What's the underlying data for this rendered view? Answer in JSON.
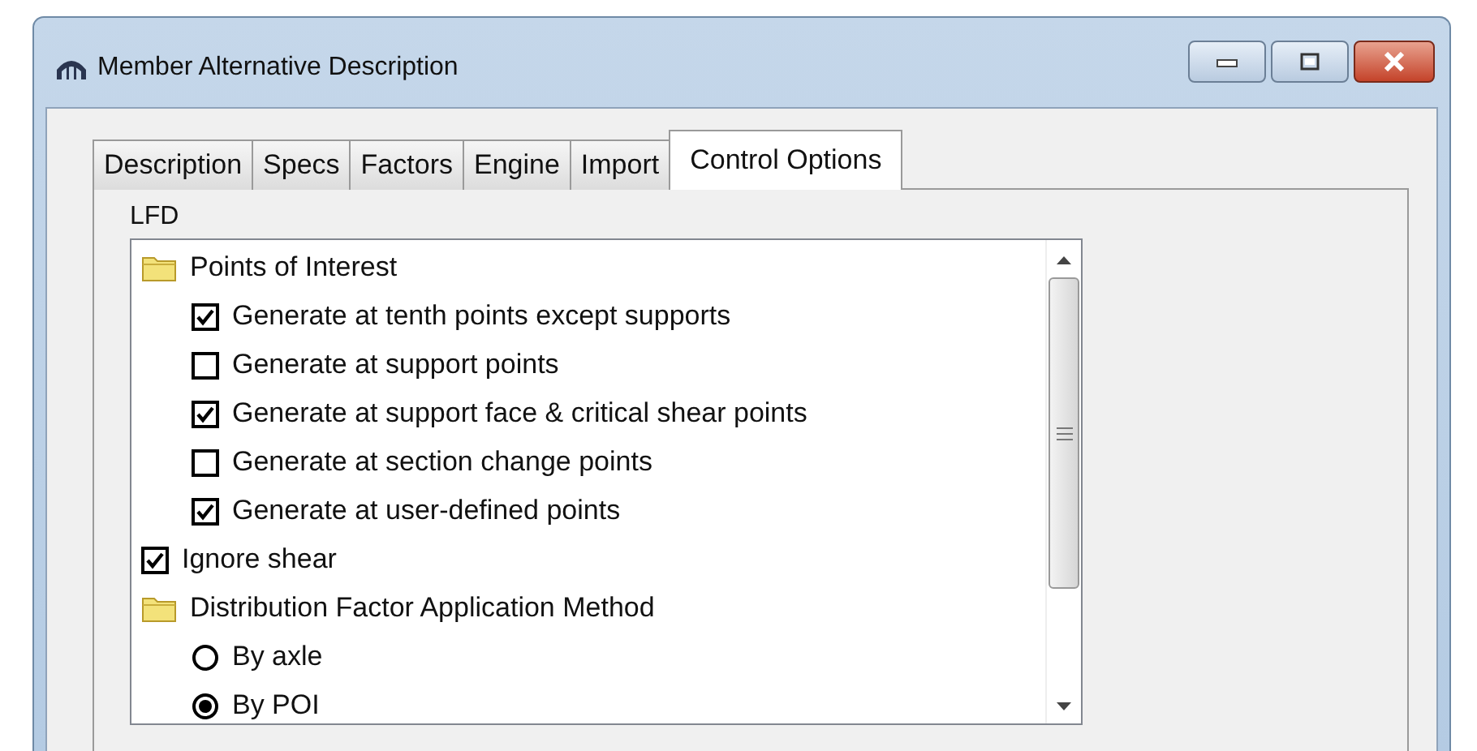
{
  "window": {
    "title": "Member Alternative Description"
  },
  "tabs": [
    {
      "label": "Description",
      "selected": false
    },
    {
      "label": "Specs",
      "selected": false
    },
    {
      "label": "Factors",
      "selected": false
    },
    {
      "label": "Engine",
      "selected": false
    },
    {
      "label": "Import",
      "selected": false
    },
    {
      "label": "Control Options",
      "selected": true
    }
  ],
  "group": {
    "label": "LFD"
  },
  "tree": [
    {
      "kind": "folder",
      "label": "Points of Interest",
      "children": [
        {
          "kind": "checkbox",
          "label": "Generate at tenth points except supports",
          "checked": true
        },
        {
          "kind": "checkbox",
          "label": "Generate at support points",
          "checked": false
        },
        {
          "kind": "checkbox",
          "label": "Generate at support face & critical shear points",
          "checked": true
        },
        {
          "kind": "checkbox",
          "label": "Generate at section change points",
          "checked": false
        },
        {
          "kind": "checkbox",
          "label": "Generate at user-defined points",
          "checked": true
        }
      ]
    },
    {
      "kind": "checkbox",
      "label": "Ignore shear",
      "checked": true
    },
    {
      "kind": "folder",
      "label": "Distribution Factor Application Method",
      "children": [
        {
          "kind": "radio",
          "label": "By axle",
          "selected": false
        },
        {
          "kind": "radio",
          "label": "By POI",
          "selected": true
        }
      ]
    }
  ]
}
